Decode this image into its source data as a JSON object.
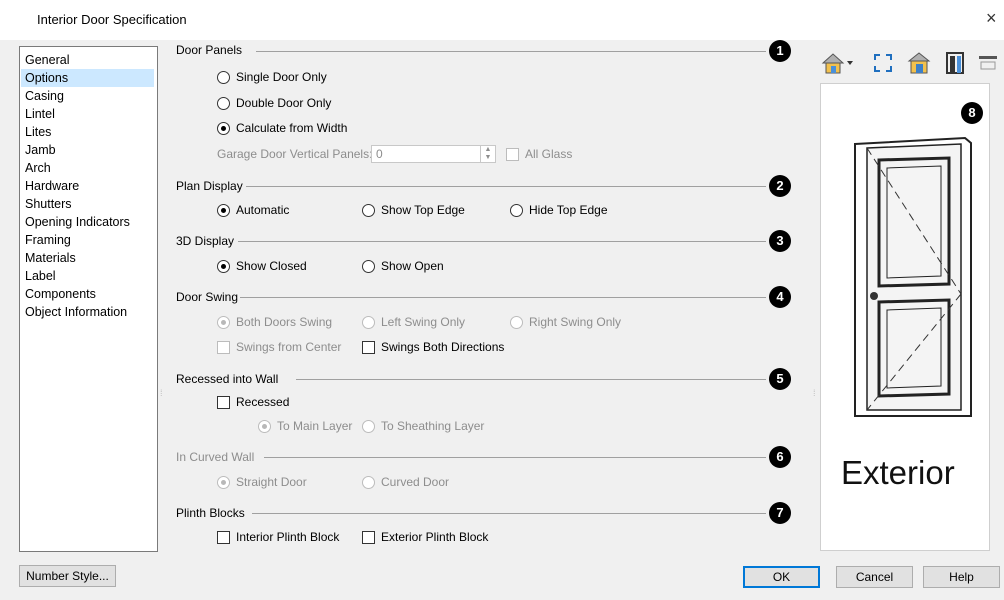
{
  "window": {
    "title": "Interior Door Specification",
    "close_glyph": "×"
  },
  "nav": {
    "items": [
      "General",
      "Options",
      "Casing",
      "Lintel",
      "Lites",
      "Jamb",
      "Arch",
      "Hardware",
      "Shutters",
      "Opening Indicators",
      "Framing",
      "Materials",
      "Label",
      "Components",
      "Object Information"
    ],
    "selected": "Options"
  },
  "sections": {
    "door_panels": {
      "title": "Door Panels",
      "number": "1",
      "options": [
        "Single Door Only",
        "Double Door Only",
        "Calculate from Width"
      ],
      "selected": "Calculate from Width",
      "garage_label": "Garage Door Vertical Panels:",
      "garage_value": "0",
      "all_glass_label": "All Glass"
    },
    "plan_display": {
      "title": "Plan Display",
      "number": "2",
      "options": [
        "Automatic",
        "Show Top Edge",
        "Hide Top Edge"
      ],
      "selected": "Automatic"
    },
    "display_3d": {
      "title": "3D Display",
      "number": "3",
      "options": [
        "Show Closed",
        "Show Open"
      ],
      "selected": "Show Closed"
    },
    "door_swing": {
      "title": "Door Swing",
      "number": "4",
      "options": [
        "Both Doors Swing",
        "Left Swing Only",
        "Right Swing Only"
      ],
      "selected": "Both Doors Swing",
      "swings_from_center": "Swings from Center",
      "swings_both_directions": "Swings Both Directions"
    },
    "recessed": {
      "title": "Recessed into Wall",
      "number": "5",
      "checkbox": "Recessed",
      "options": [
        "To Main Layer",
        "To Sheathing Layer"
      ],
      "selected": "To Main Layer"
    },
    "curved_wall": {
      "title": "In Curved Wall",
      "number": "6",
      "options": [
        "Straight Door",
        "Curved Door"
      ],
      "selected": "Straight Door"
    },
    "plinth": {
      "title": "Plinth Blocks",
      "number": "7",
      "options": [
        "Interior Plinth Block",
        "Exterior Plinth Block"
      ]
    }
  },
  "preview": {
    "number": "8",
    "caption": "Exterior"
  },
  "toolbar": {
    "icons": [
      "view-home-icon",
      "fill-window-icon",
      "render-door-icon",
      "door-frame-icon",
      "preview-options-icon"
    ]
  },
  "buttons": {
    "number_style": "Number Style...",
    "ok": "OK",
    "cancel": "Cancel",
    "help": "Help"
  },
  "colors": {
    "selection": "#cce8ff",
    "default_button_border": "#0078d7",
    "disabled_text": "#8d8d8d"
  }
}
